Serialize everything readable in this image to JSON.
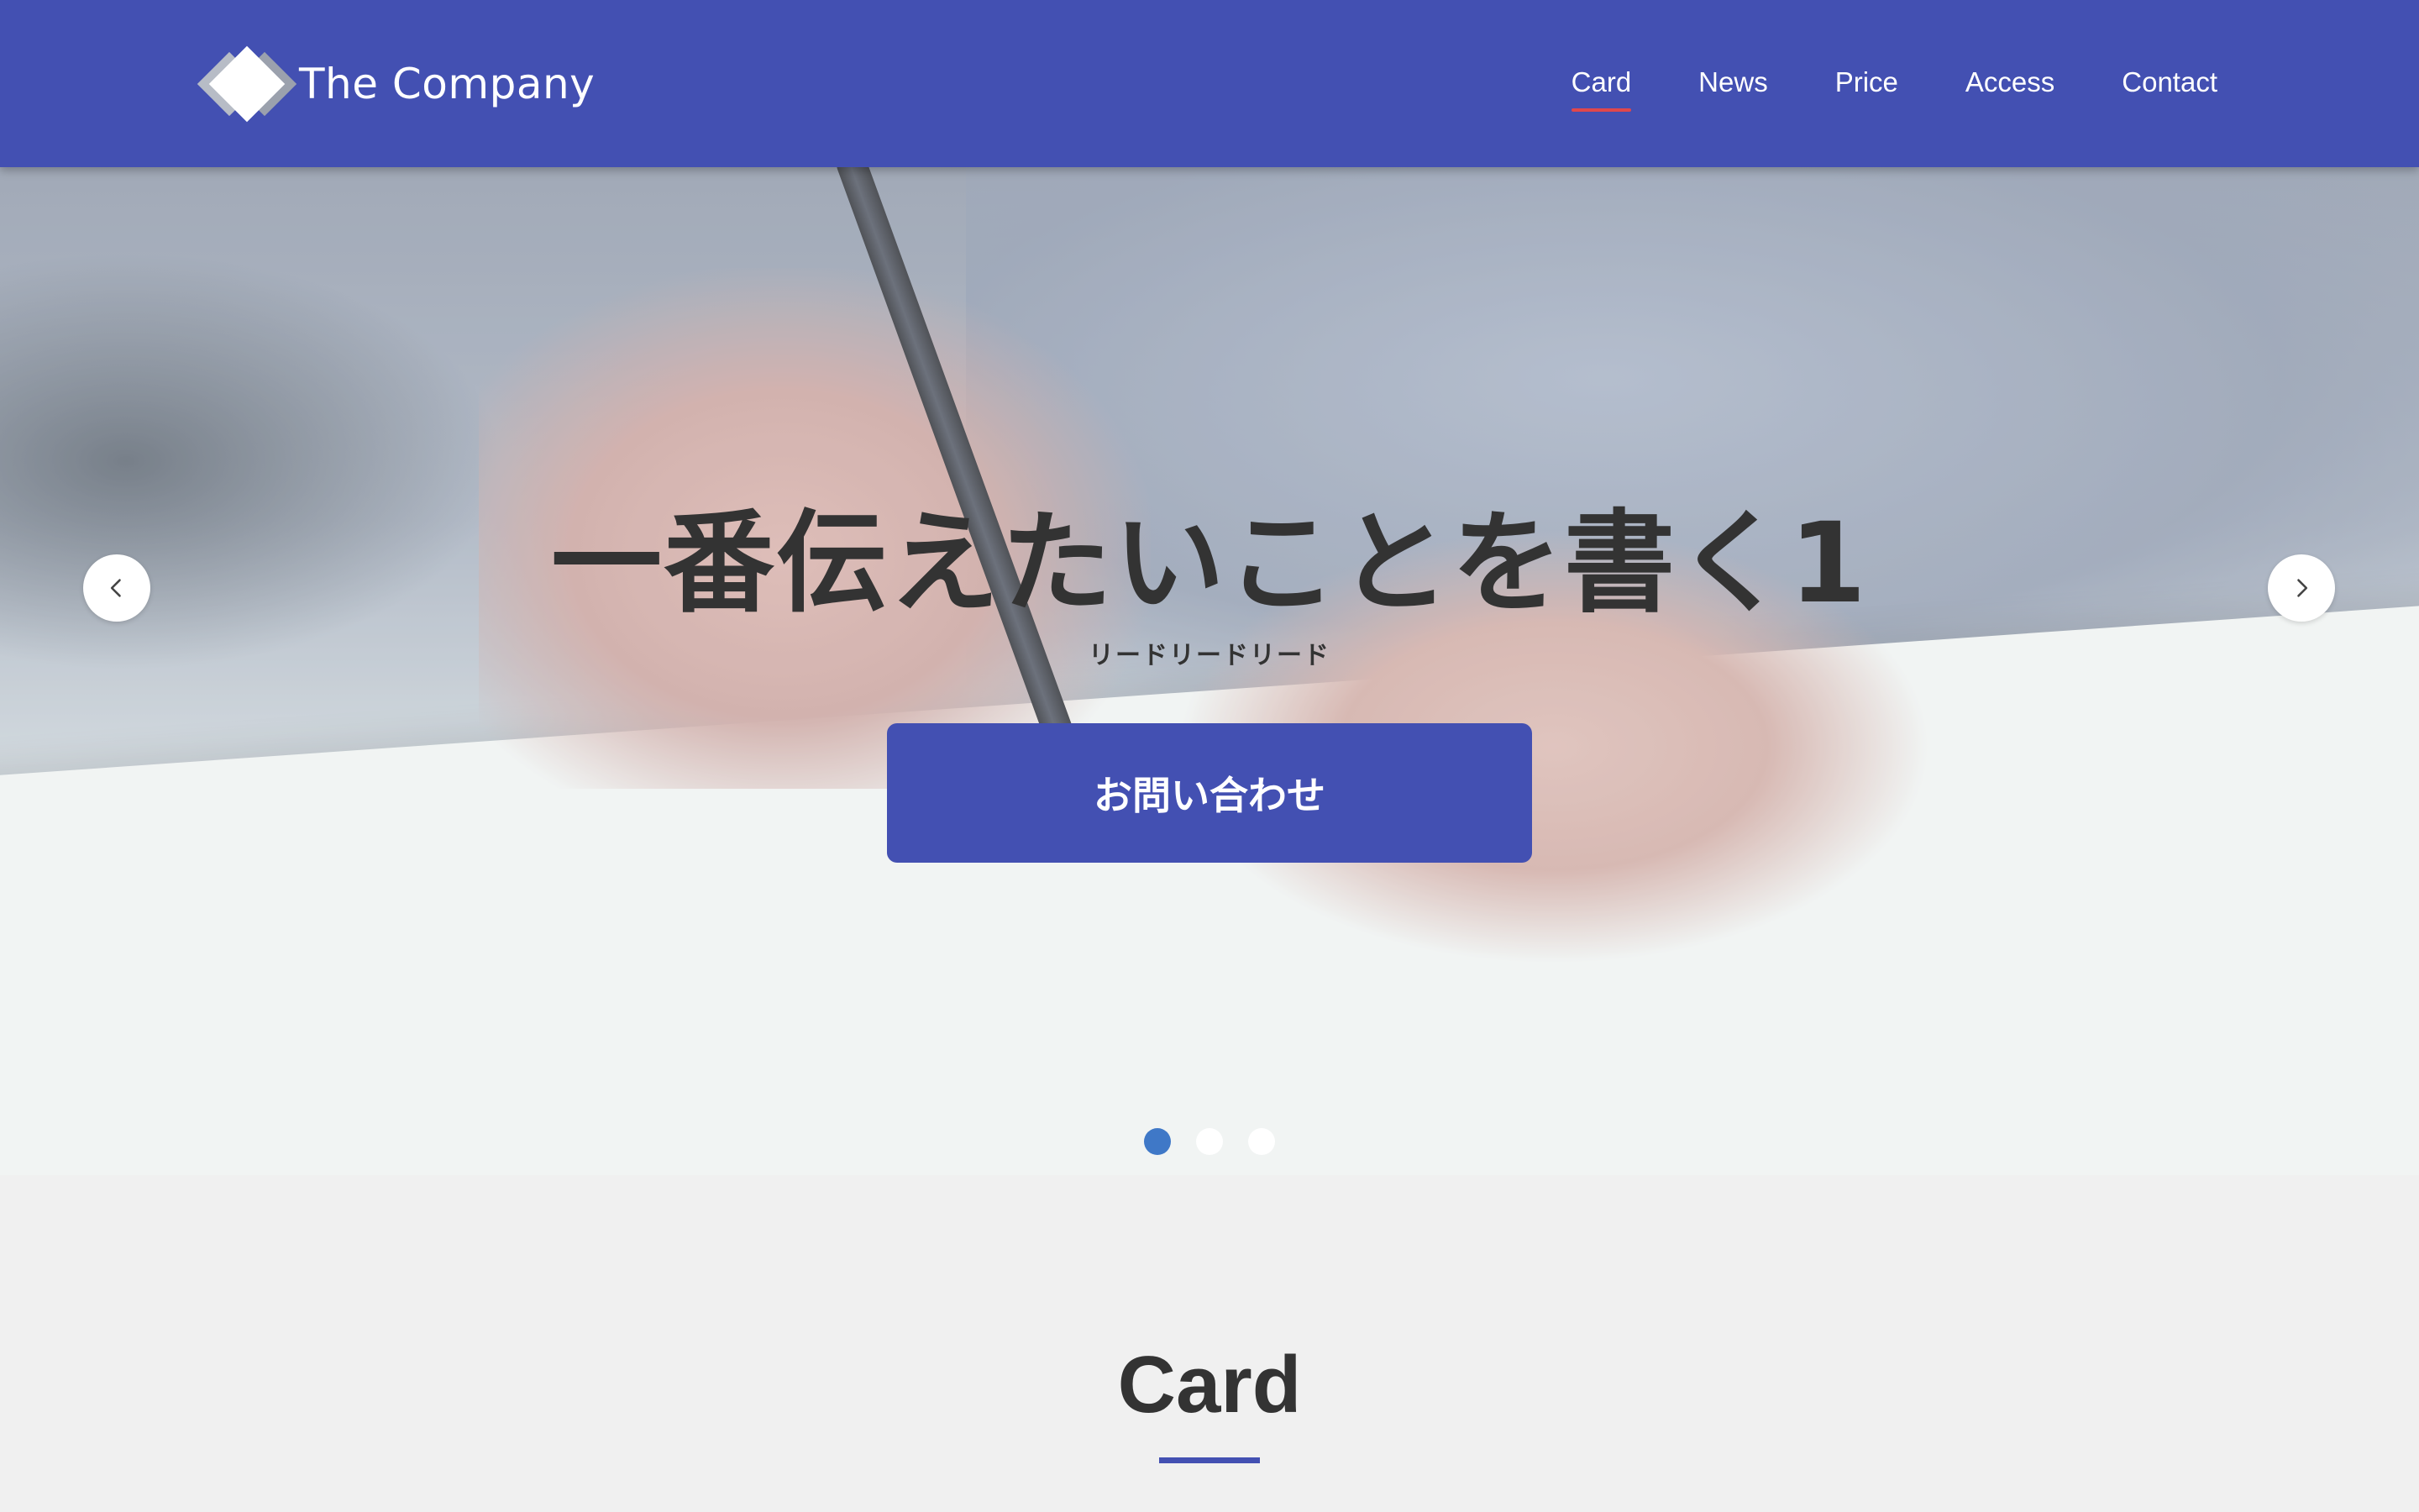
{
  "header": {
    "logo_text": "The Company",
    "nav": [
      {
        "label": "Card",
        "active": true
      },
      {
        "label": "News",
        "active": false
      },
      {
        "label": "Price",
        "active": false
      },
      {
        "label": "Access",
        "active": false
      },
      {
        "label": "Contact",
        "active": false
      }
    ]
  },
  "hero": {
    "title": "一番伝えたいことを書く1",
    "lead": "リードリードリード",
    "button_label": "お問い合わせ",
    "prev_icon": "chevron-left-icon",
    "next_icon": "chevron-right-icon",
    "slides_total": 3,
    "active_slide": 1
  },
  "section": {
    "title": "Card"
  },
  "colors": {
    "primary": "#4350b2",
    "nav_active_underline": "#e0474c",
    "dot_active": "#3f78c7",
    "text_dark": "#333333",
    "section_bg": "#f0f0f0"
  }
}
